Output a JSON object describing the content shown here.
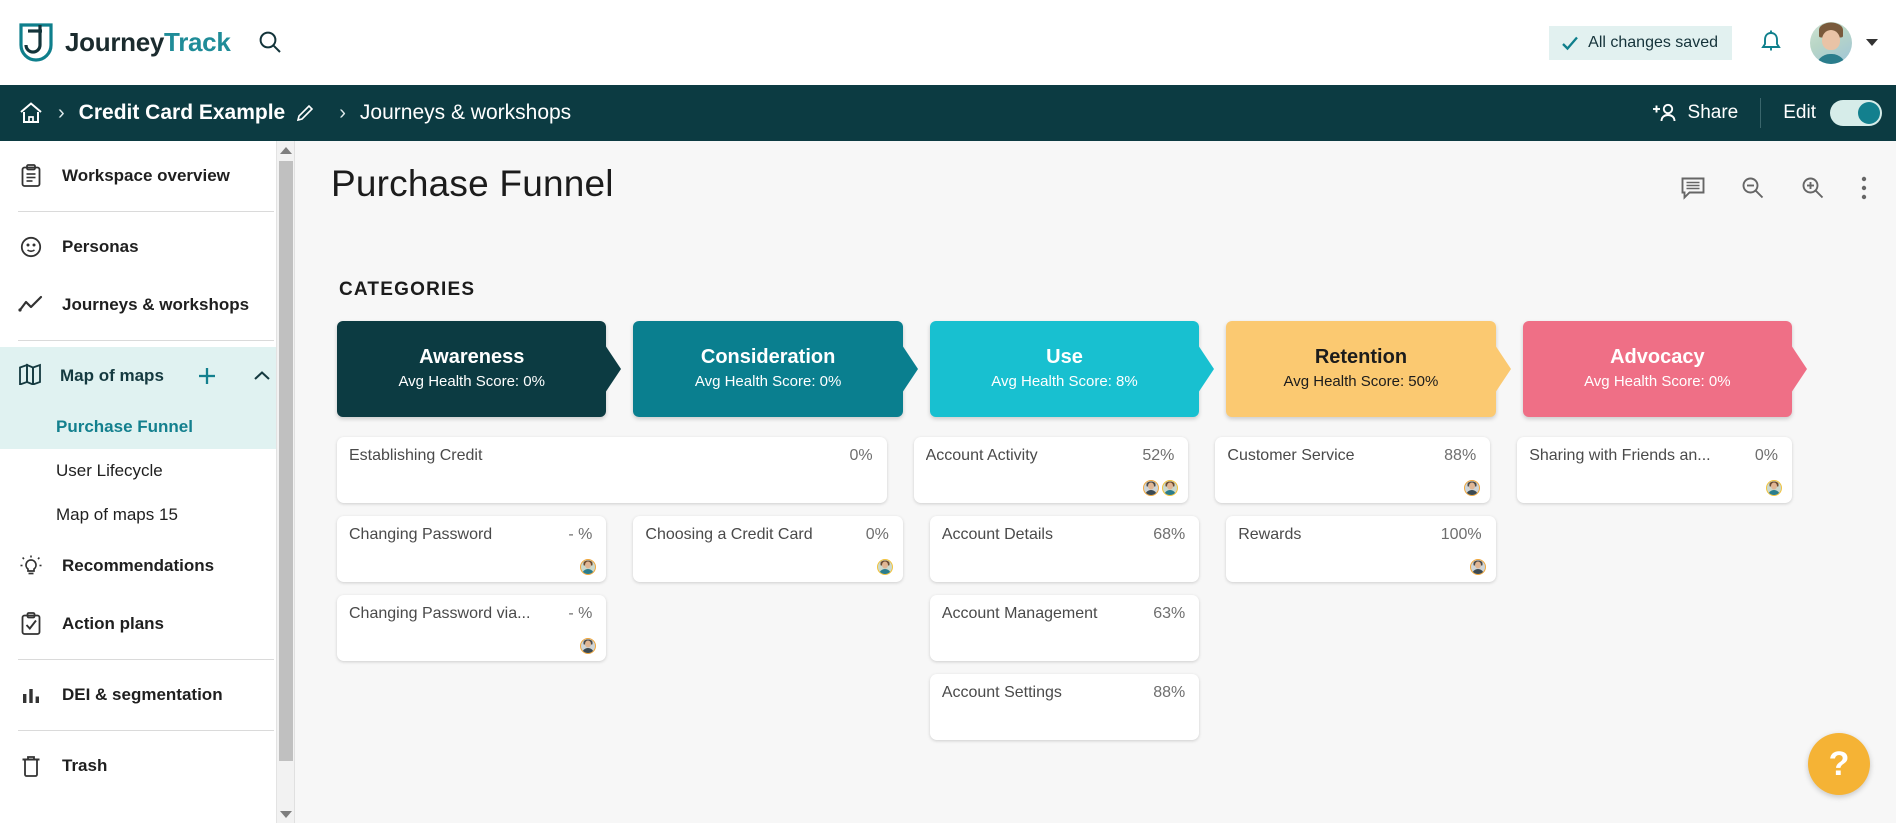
{
  "app": {
    "brand_first": "Journey",
    "brand_second": "Track",
    "search_icon": "search-icon"
  },
  "header": {
    "saved_status": "All changes saved",
    "check_icon": "check-icon",
    "bell_icon": "notification-bell-icon",
    "avatar": "user-avatar",
    "caret": "chevron-down-icon"
  },
  "breadcrumb": {
    "home_icon": "home-icon",
    "sep": "›",
    "workspace": "Credit Card Example",
    "pencil_icon": "pencil-edit-icon",
    "section": "Journeys & workshops",
    "share_label": "Share",
    "share_icon": "add-person-icon",
    "edit_label": "Edit",
    "edit_toggle_on": true
  },
  "sidebar": {
    "items": [
      {
        "label": "Workspace overview",
        "icon": "clipboard-icon"
      },
      {
        "label": "Personas",
        "icon": "persona-face-icon"
      },
      {
        "label": "Journeys & workshops",
        "icon": "trend-line-icon"
      }
    ],
    "map_of_maps": {
      "label": "Map of maps",
      "icon": "map-icon",
      "add_icon": "plus-icon",
      "collapse_icon": "chevron-up-icon",
      "children": [
        {
          "label": "Purchase Funnel",
          "active": true
        },
        {
          "label": "User Lifecycle",
          "active": false
        },
        {
          "label": "Map of maps 15",
          "active": false
        }
      ]
    },
    "items_after": [
      {
        "label": "Recommendations",
        "icon": "lightbulb-icon"
      },
      {
        "label": "Action plans",
        "icon": "checklist-icon"
      },
      {
        "label": "DEI & segmentation",
        "icon": "bar-chart-icon"
      },
      {
        "label": "Trash",
        "icon": "trash-icon"
      }
    ],
    "scroll_up_icon": "scroll-up-arrow",
    "scroll_down_icon": "scroll-down-arrow"
  },
  "main": {
    "title": "Purchase Funnel",
    "tools": [
      {
        "name": "comment-icon"
      },
      {
        "name": "zoom-out-icon"
      },
      {
        "name": "zoom-in-icon"
      },
      {
        "name": "more-options-icon"
      }
    ],
    "categories_label": "CATEGORIES",
    "help_label": "?"
  },
  "chart_data": {
    "type": "table",
    "title": "Purchase Funnel",
    "stages": [
      {
        "name": "Awareness",
        "score_label": "Avg Health Score: 0%",
        "score": 0,
        "color": "#0c3b42",
        "text_color": "#ffffff"
      },
      {
        "name": "Consideration",
        "score_label": "Avg Health Score: 0%",
        "score": 0,
        "color": "#0a7f8f",
        "text_color": "#ffffff"
      },
      {
        "name": "Use",
        "score_label": "Avg Health Score: 8%",
        "score": 8,
        "color": "#18c0d0",
        "text_color": "#ffffff"
      },
      {
        "name": "Retention",
        "score_label": "Avg Health Score: 50%",
        "score": 50,
        "color": "#fbc971",
        "text_color": "#1c1c1c"
      },
      {
        "name": "Advocacy",
        "score_label": "Avg Health Score: 0%",
        "score": 0,
        "color": "#ef6f86",
        "text_color": "#ffffff"
      }
    ],
    "columns": [
      {
        "stage": "Awareness",
        "cards": [
          {
            "name": "Establishing Credit",
            "pct": "0%",
            "span": 2,
            "avatars": []
          },
          {
            "name": "Changing Password",
            "pct": "- %",
            "span": 1,
            "avatars": [
              "orange"
            ]
          },
          {
            "name": "Changing Password via...",
            "pct": "- %",
            "span": 1,
            "avatars": [
              "orange"
            ]
          }
        ]
      },
      {
        "stage": "Consideration",
        "cards": [
          {
            "name": "Choosing a Credit Card",
            "pct": "0%",
            "span": 1,
            "avatars": [
              "yellow"
            ]
          }
        ]
      },
      {
        "stage": "Use",
        "cards": [
          {
            "name": "Account Activity",
            "pct": "52%",
            "span": 1,
            "avatars": [
              "orange",
              "yellow"
            ]
          },
          {
            "name": "Account Details",
            "pct": "68%",
            "span": 1,
            "avatars": []
          },
          {
            "name": "Account Management",
            "pct": "63%",
            "span": 1,
            "avatars": []
          },
          {
            "name": "Account Settings",
            "pct": "88%",
            "span": 1,
            "avatars": []
          }
        ]
      },
      {
        "stage": "Retention",
        "cards": [
          {
            "name": "Customer Service",
            "pct": "88%",
            "span": 1,
            "avatars": [
              "orange"
            ]
          },
          {
            "name": "Rewards",
            "pct": "100%",
            "span": 1,
            "avatars": [
              "orange"
            ]
          }
        ]
      },
      {
        "stage": "Advocacy",
        "cards": [
          {
            "name": "Sharing with Friends an...",
            "pct": "0%",
            "span": 1,
            "avatars": [
              "yellow"
            ]
          }
        ]
      }
    ]
  }
}
